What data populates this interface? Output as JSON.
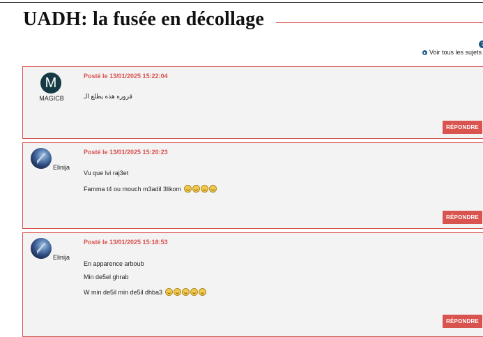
{
  "page": {
    "title": "UADH: la fusée en décollage",
    "view_all_label": "Voir tous les sujets",
    "top_icon_symbol": "?"
  },
  "colors": {
    "accent": "#d9534f",
    "post_bg": "#f3f3f3",
    "link_icon": "#1e5a86"
  },
  "posts": [
    {
      "author": "MAGICB",
      "avatar_letter": "M",
      "posted": "Posté le 13/01/2025 15:22:04",
      "lines": [
        "قزوره هذه يطلع الـ"
      ],
      "reply_label": "RÉPONDRE"
    },
    {
      "author": "Elinija",
      "avatar_icon": "user-photo-icon",
      "posted": "Posté le 13/01/2025 15:20:23",
      "lines": [
        "Vu que lvi raj3et",
        "Famma t4 ou mouch m3adil 3likom"
      ],
      "emoji_icon": "grinning-face-icon",
      "reply_label": "RÉPONDRE"
    },
    {
      "author": "Elinija",
      "avatar_icon": "user-photo-icon",
      "posted": "Posté le 13/01/2025 15:18:53",
      "lines": [
        "En apparence arboub",
        "Min de5el ghrab",
        "W min de5il min de5il dhba3"
      ],
      "emoji_icon": "laughing-face-icon",
      "reply_label": "RÉPONDRE"
    }
  ]
}
